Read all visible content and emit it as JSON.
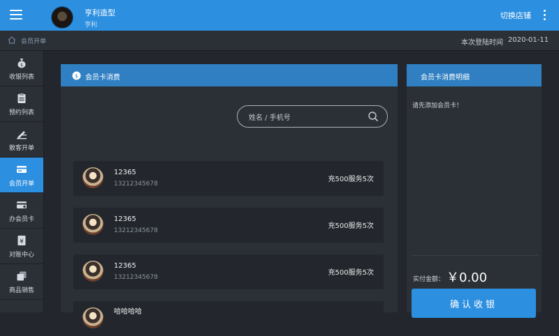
{
  "header": {
    "shop_name": "亨利造型",
    "shop_sub": "亨利",
    "switch_store": "切换店铺",
    "menu_icon": "hamburger-menu-icon",
    "more_icon": "more-vertical-icon"
  },
  "breadcrumb": {
    "page": "会员开单",
    "login_label": "本次登陆时间",
    "login_date": "2020-01-11"
  },
  "sidebar": {
    "items": [
      {
        "label": "收银列表",
        "icon": "money-bag-icon"
      },
      {
        "label": "预约列表",
        "icon": "clipboard-icon"
      },
      {
        "label": "散客开单",
        "icon": "pen-ruler-icon"
      },
      {
        "label": "会员开单",
        "icon": "member-card-icon",
        "active": true
      },
      {
        "label": "办会员卡",
        "icon": "add-card-icon"
      },
      {
        "label": "对账中心",
        "icon": "yen-document-icon"
      },
      {
        "label": "商品销售",
        "icon": "stack-icon"
      }
    ]
  },
  "left_panel": {
    "title": "会员卡消费",
    "search_placeholder": "姓名 / 手机号",
    "cards": [
      {
        "name": "12365",
        "phone": "13212345678",
        "service": "充500服务5次"
      },
      {
        "name": "12365",
        "phone": "13212345678",
        "service": "充500服务5次"
      },
      {
        "name": "12365",
        "phone": "13212345678",
        "service": "充500服务5次"
      },
      {
        "name": "哈哈哈哈",
        "phone": "",
        "service": ""
      }
    ]
  },
  "right_panel": {
    "title": "会员卡消费明细",
    "note": "请先添加会员卡！",
    "total_label": "实付金额：",
    "total_value": "￥0.00",
    "confirm_label": "确认收银"
  },
  "colors": {
    "accent": "#2c8fe0",
    "panel_header": "#2f7fc2",
    "background": "#23272d",
    "panel": "#2b2f36"
  }
}
